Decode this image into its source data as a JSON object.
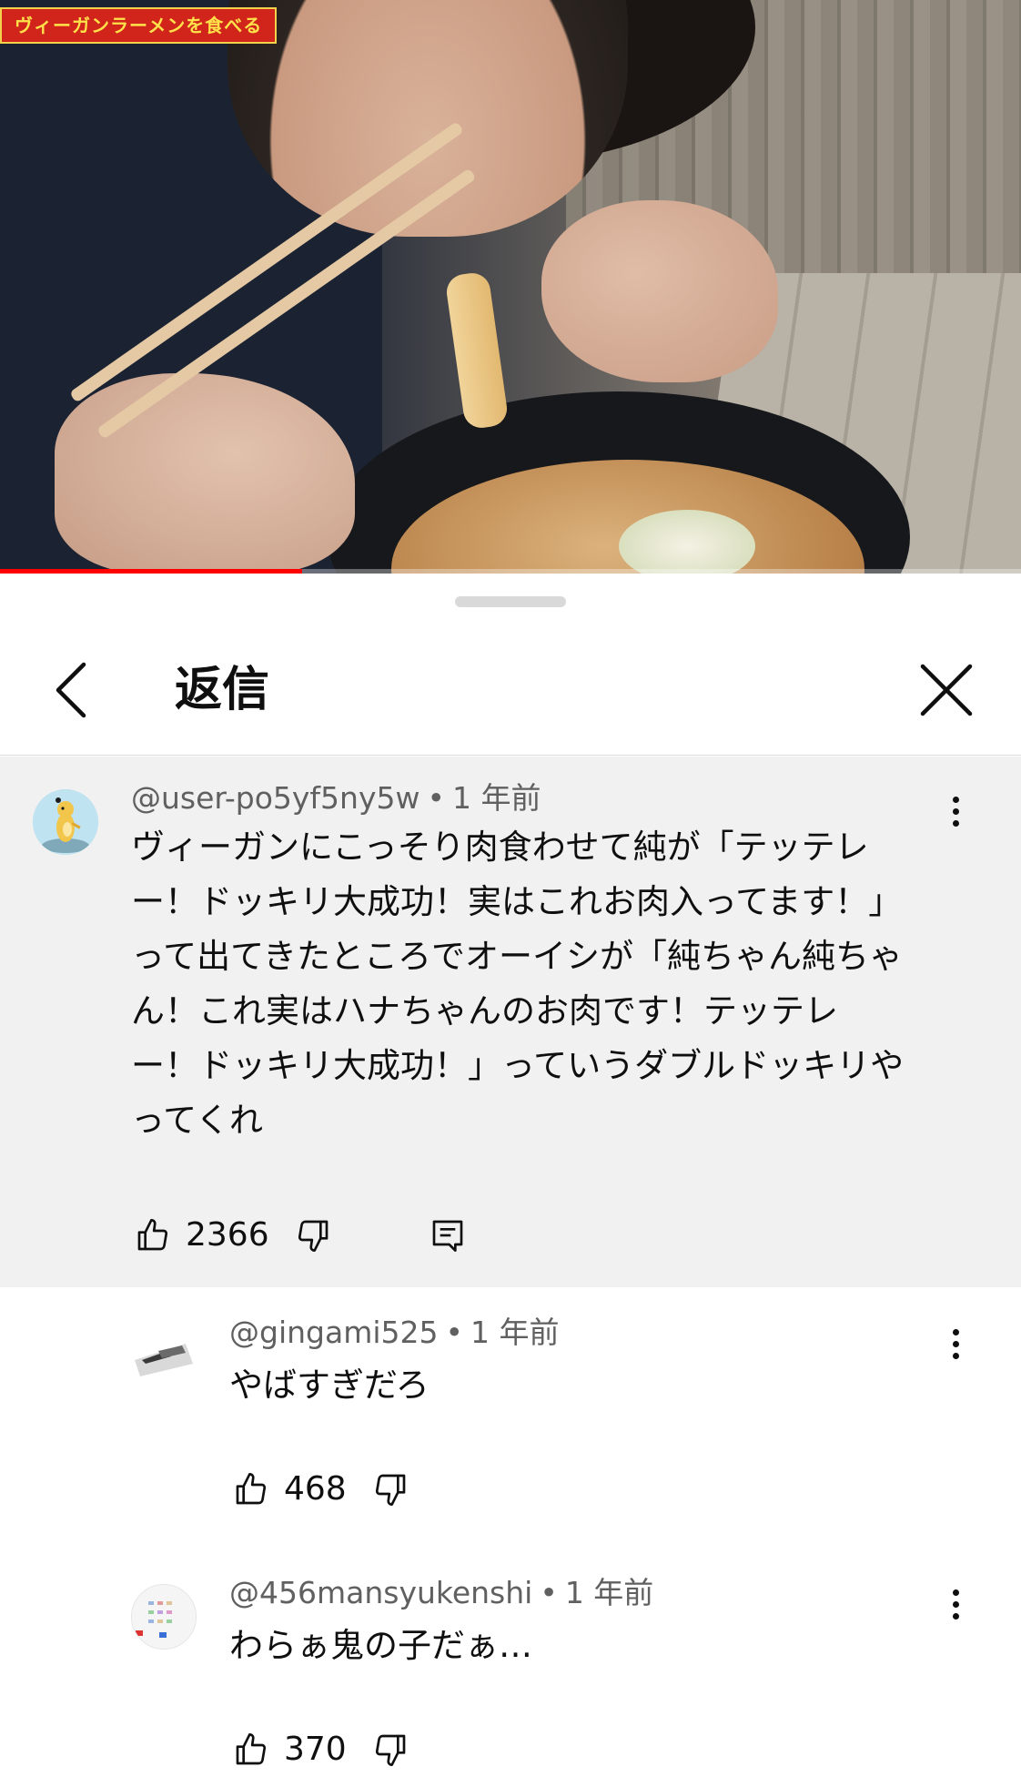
{
  "video": {
    "title_overlay": "ヴィーガンラーメンを食べる",
    "progress_fraction": 0.296
  },
  "sheet": {
    "title": "返信"
  },
  "parent_comment": {
    "handle": "@user-po5yf5ny5w",
    "time": "1 年前",
    "lines": [
      "ヴィーガンにこっそり肉食わせて純が「テッテレ",
      "ー！ドッキリ大成功！実はこれお肉入ってます！」",
      "って出てきたところでオーイシが「純ちゃん純ちゃ",
      "ん！これ実はハナちゃんのお肉です！テッテレ",
      "ー！ドッキリ大成功！」っていうダブルドッキリや",
      "ってくれ"
    ],
    "likes": "2366"
  },
  "replies": [
    {
      "handle": "@gingami525",
      "time": "1 年前",
      "text": "やばすぎだろ",
      "likes": "468"
    },
    {
      "handle": "@456mansyukenshi",
      "time": "1 年前",
      "text": "わらぁ鬼の子だぁ…",
      "likes": "370"
    }
  ],
  "separator": "•",
  "icons": {
    "back": "chevron-left-icon",
    "close": "close-icon",
    "like": "thumbs-up-icon",
    "dislike": "thumbs-down-icon",
    "reply": "comment-icon",
    "more": "more-vertical-icon"
  },
  "colors": {
    "progress": "#ff0000",
    "title_tag_bg": "#d1241b",
    "title_tag_text": "#ffe14a",
    "parent_bg": "#f1f1f1",
    "meta_text": "#606060"
  }
}
